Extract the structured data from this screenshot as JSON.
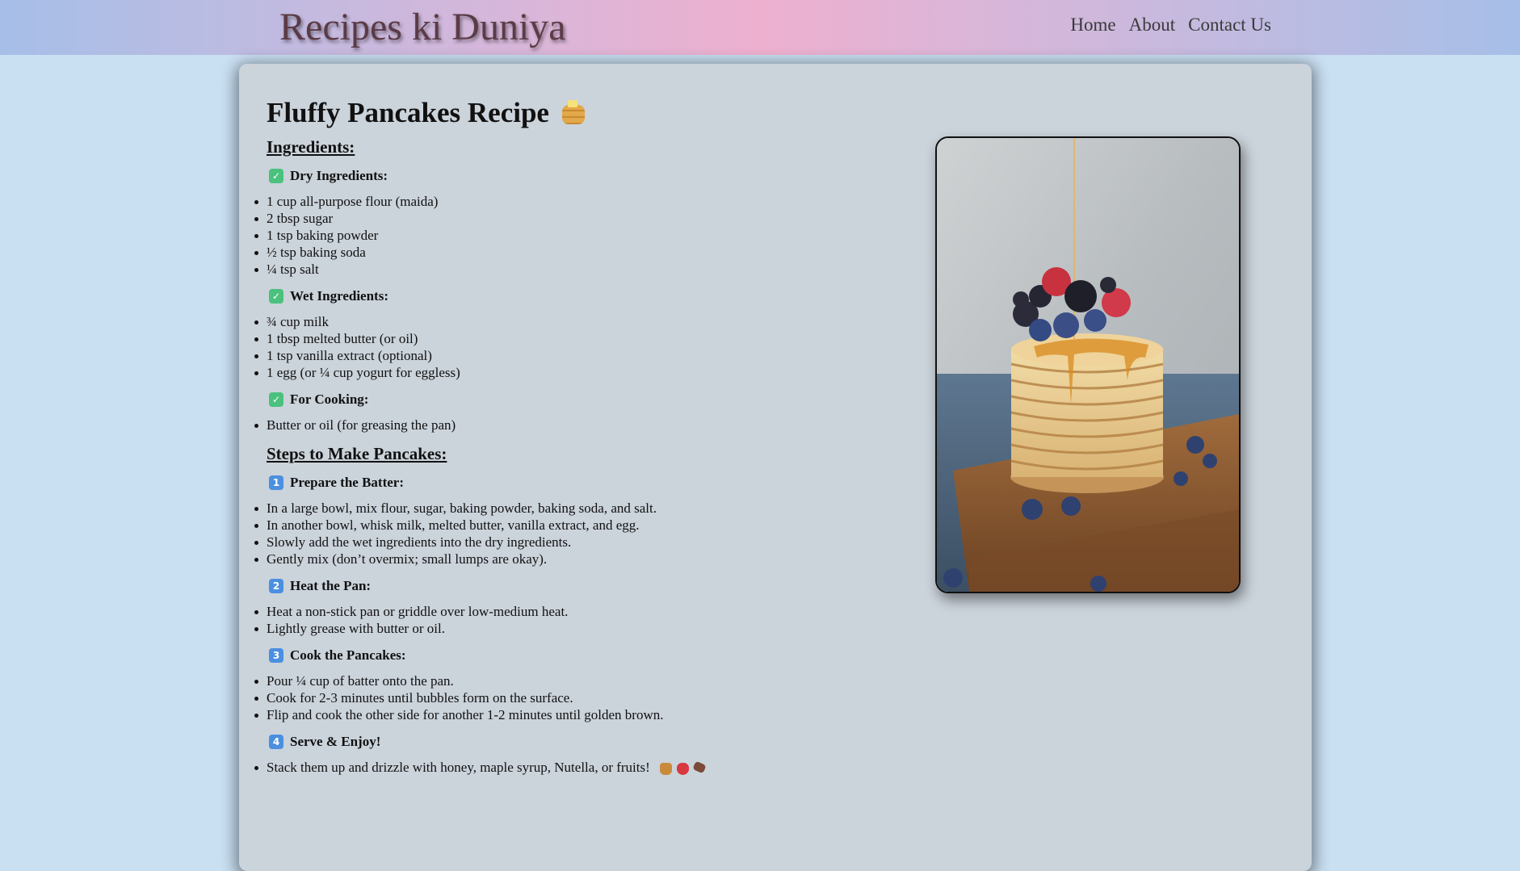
{
  "header": {
    "brand": "Recipes ki Duniya",
    "nav": [
      "Home",
      "About",
      "Contact Us"
    ]
  },
  "recipe": {
    "title": "Fluffy Pancakes Recipe",
    "title_icon": "pancakes-emoji",
    "ingredients_heading": "Ingredients:",
    "dry": {
      "label": "Dry Ingredients:",
      "icon": "check-mark-button-emoji",
      "items": [
        "1 cup all-purpose flour (maida)",
        "2 tbsp sugar",
        "1 tsp baking powder",
        "½ tsp baking soda",
        "¼ tsp salt"
      ]
    },
    "wet": {
      "label": "Wet Ingredients:",
      "icon": "check-mark-button-emoji",
      "items": [
        "¾ cup milk",
        "1 tbsp melted butter (or oil)",
        "1 tsp vanilla extract (optional)",
        "1 egg (or ¼ cup yogurt for eggless)"
      ]
    },
    "cooking": {
      "label": "For Cooking:",
      "icon": "check-mark-button-emoji",
      "items": [
        "Butter or oil (for greasing the pan)"
      ]
    },
    "steps_heading": "Steps to Make Pancakes:",
    "steps": [
      {
        "badge": "1",
        "label": "Prepare the Batter:",
        "items": [
          "In a large bowl, mix flour, sugar, baking powder, baking soda, and salt.",
          "In another bowl, whisk milk, melted butter, vanilla extract, and egg.",
          "Slowly add the wet ingredients into the dry ingredients.",
          "Gently mix (don’t overmix; small lumps are okay)."
        ]
      },
      {
        "badge": "2",
        "label": "Heat the Pan:",
        "items": [
          "Heat a non-stick pan or griddle over low-medium heat.",
          "Lightly grease with butter or oil."
        ]
      },
      {
        "badge": "3",
        "label": "Cook the Pancakes:",
        "items": [
          "Pour ¼ cup of batter onto the pan.",
          "Cook for 2-3 minutes until bubbles form on the surface.",
          "Flip and cook the other side for another 1-2 minutes until golden brown."
        ]
      },
      {
        "badge": "4",
        "label": "Serve & Enjoy!",
        "items": [
          "Stack them up and drizzle with honey, maple syrup, Nutella, or fruits!"
        ],
        "trailing_icons": [
          "honey-pot-emoji",
          "strawberry-emoji",
          "chocolate-bar-emoji"
        ]
      }
    ],
    "image": "pancake-stack-photo"
  },
  "colors": {
    "page_bg": "#c9dff2",
    "card_bg": "#cbd3db",
    "header_gradient_edge": "#a6bfe8",
    "header_gradient_center": "#eeb0cf",
    "brand_text": "#5b3b46",
    "check_badge": "#4ac27e",
    "number_badge": "#4b8fe0"
  }
}
